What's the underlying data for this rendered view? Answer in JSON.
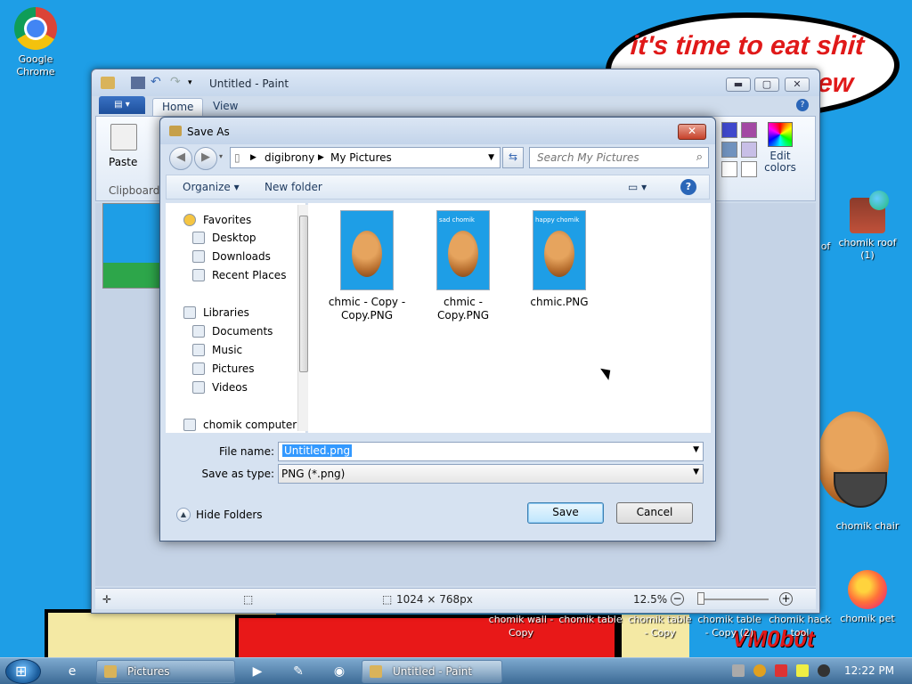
{
  "desktop": {
    "speech_line1": "it's time to eat shit",
    "speech_line2": "ew",
    "watermark": "VM0b0t",
    "icons": [
      {
        "label": "Google Chrome"
      },
      {
        "label": "chomik roof (1)"
      },
      {
        "label": "chomik chair"
      },
      {
        "label": "chomik pet"
      },
      {
        "label": "of"
      }
    ],
    "bottom_labels": [
      {
        "label": "chomik wall - Copy"
      },
      {
        "label": "chomik table"
      },
      {
        "label": "chomik table - Copy"
      },
      {
        "label": "chomik table - Copy (2)"
      },
      {
        "label": "chomik hack tool"
      }
    ]
  },
  "paint": {
    "title": "Untitled - Paint",
    "tabs": [
      "Home",
      "View"
    ],
    "ribbon": {
      "paste": "Paste",
      "clipboard": "Clipboard",
      "edit_colors": "Edit colors",
      "swatches": [
        "#3f48cc",
        "#a349a4",
        "#7092be",
        "#c8bfe7",
        "#ffffff",
        "#ffffff"
      ]
    },
    "status": {
      "dimensions": "1024 × 768px",
      "zoom": "12.5%"
    }
  },
  "dialog": {
    "title": "Save As",
    "breadcrumb": [
      "digibrony",
      "My Pictures"
    ],
    "search_placeholder": "Search My Pictures",
    "toolbar": {
      "organize": "Organize",
      "new_folder": "New folder"
    },
    "nav": {
      "favorites": "Favorites",
      "favorites_items": [
        "Desktop",
        "Downloads",
        "Recent Places"
      ],
      "libraries": "Libraries",
      "libraries_items": [
        "Documents",
        "Music",
        "Pictures",
        "Videos"
      ],
      "computer": "chomik computer"
    },
    "files": [
      {
        "name": "chmic - Copy - Copy.PNG",
        "caption": ""
      },
      {
        "name": "chmic - Copy.PNG",
        "caption": "sad chomik"
      },
      {
        "name": "chmic.PNG",
        "caption": "happy chomik"
      }
    ],
    "file_name_label": "File name:",
    "file_name_value": "Untitled.png",
    "save_type_label": "Save as type:",
    "save_type_value": "PNG (*.png)",
    "hide_folders": "Hide Folders",
    "save": "Save",
    "cancel": "Cancel"
  },
  "taskbar": {
    "tasks": [
      "Pictures",
      "Untitled - Paint"
    ],
    "clock": "12:22 PM"
  }
}
